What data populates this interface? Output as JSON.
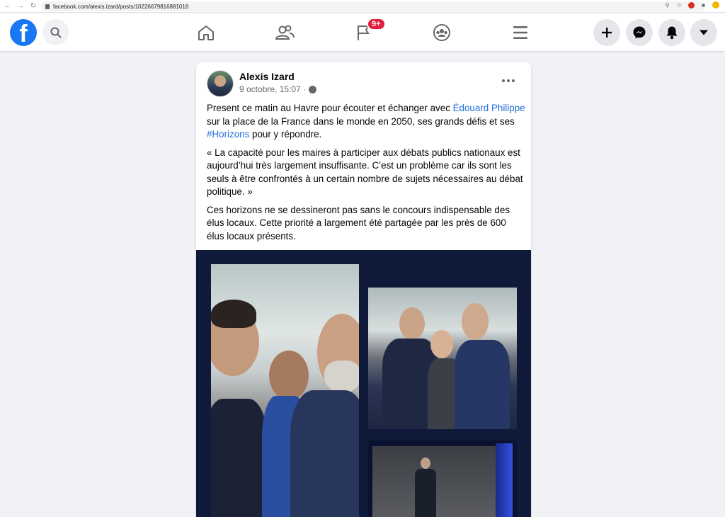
{
  "browser": {
    "url": "facebook.com/alexis.izard/posts/10226679816881018",
    "back_icon": "arrow-left-icon",
    "forward_icon": "arrow-right-icon",
    "reload_icon": "reload-icon"
  },
  "header": {
    "logo_letter": "f",
    "notification_badge": "9+",
    "nav_icons": [
      "home-icon",
      "friends-icon",
      "pages-icon",
      "groups-icon",
      "menu-icon"
    ],
    "right_buttons": [
      "create-button",
      "messenger-button",
      "notifications-button",
      "account-button"
    ]
  },
  "post": {
    "author": "Alexis Izard",
    "timestamp": "9 octobre, 15:07 ·",
    "paragraph1": {
      "pre": "Present ce matin au Havre pour écouter et échanger avec ",
      "mention": "Édouard Philippe",
      "mid": " sur la place de la France dans le monde en 2050, ses grands défis et ses ",
      "hashtag": "#Horizons",
      "post": " pour y répondre."
    },
    "paragraph2": "« La capacité pour les maires à participer aux débats publics nationaux est aujourd’hui très largement insuffisante. C’est un problème car ils sont les seuls à être confrontés à un certain nombre de sujets nécessaires au débat politique. »",
    "paragraph3": "Ces horizons ne se dessineront pas sans le concours indispensable des élus locaux. Cette priorité a largement été partagée par les près de 600 élus locaux présents."
  }
}
